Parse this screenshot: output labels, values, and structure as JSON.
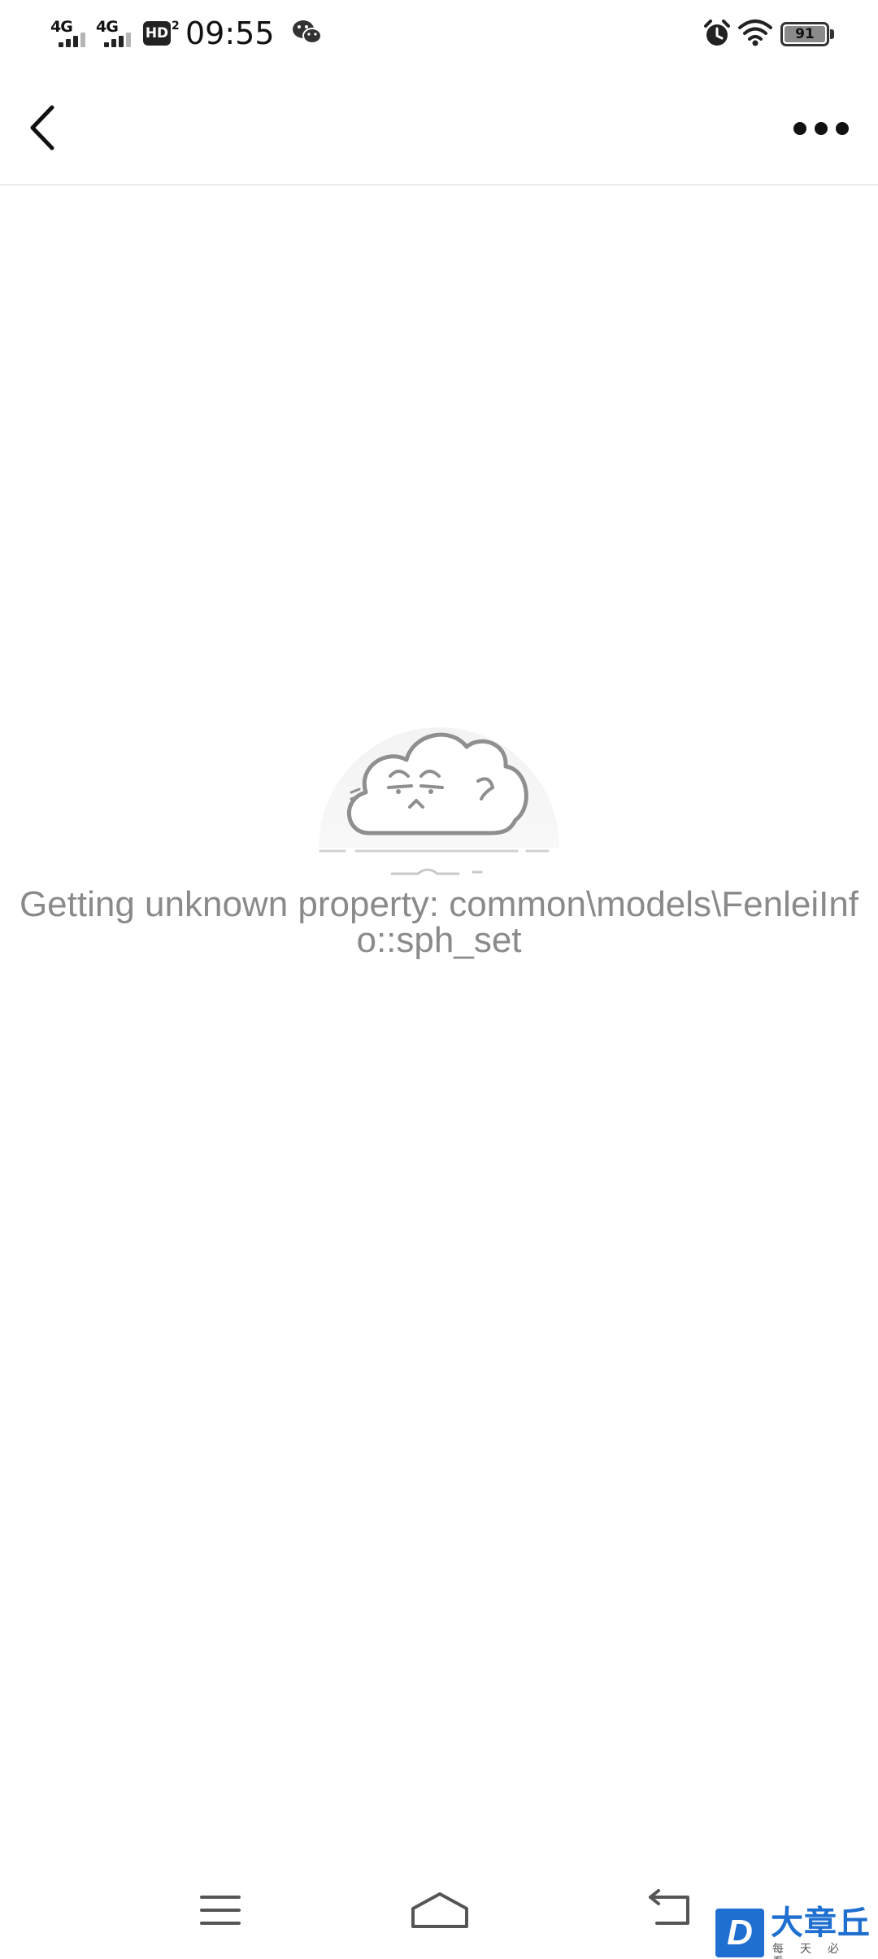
{
  "status_bar": {
    "sim1_network": "4G",
    "sim2_network": "4G",
    "hd_label": "HD",
    "hd_sub": "2",
    "time": "09:55",
    "battery_level": "91",
    "icons": [
      "signal-icon",
      "hd-volte-icon",
      "wechat-notification-icon",
      "alarm-icon",
      "wifi-icon",
      "battery-icon"
    ]
  },
  "nav": {
    "back_icon": "chevron-left-icon",
    "more_icon": "more-dots-icon"
  },
  "empty_state": {
    "illustration": "cloud-face-illustration",
    "message": "Getting unknown property: common\\models\\FenleiInfo::sph_set"
  },
  "system_nav": {
    "icons": [
      "menu-icon",
      "home-icon",
      "back-arrow-icon"
    ]
  },
  "watermark": {
    "badge_letter": "D",
    "title": "大章丘",
    "subtitle": "每天必看"
  },
  "colors": {
    "background": "#ffffff",
    "message_text": "#8a8a8a",
    "divider": "#ececec",
    "watermark_blue": "#1f6fd1"
  }
}
